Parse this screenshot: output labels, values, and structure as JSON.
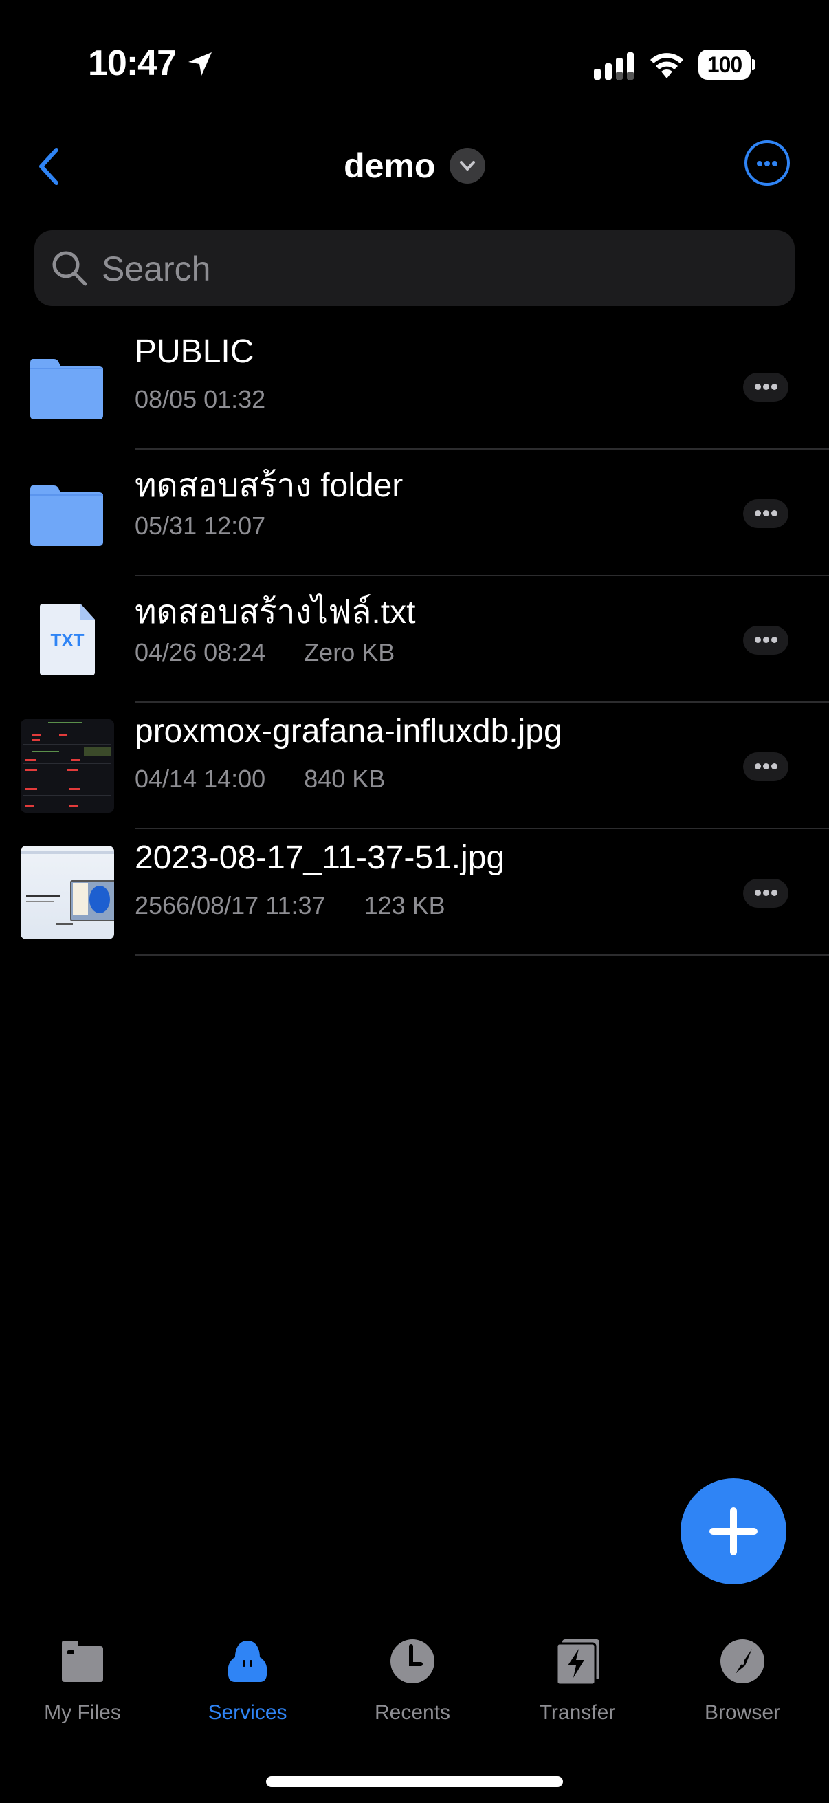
{
  "status_bar": {
    "time": "10:47",
    "battery": "100"
  },
  "nav": {
    "title": "demo",
    "back_icon": "chevron-left-icon",
    "more_icon": "ellipsis-circle-icon",
    "dropdown_icon": "chevron-down-icon"
  },
  "search": {
    "placeholder": "Search",
    "value": ""
  },
  "files": [
    {
      "name": "PUBLIC",
      "date": "08/05 01:32",
      "size": "",
      "type": "folder"
    },
    {
      "name": "ทดสอบสร้าง folder",
      "date": "05/31 12:07",
      "size": "",
      "type": "folder"
    },
    {
      "name": "ทดสอบสร้างไฟล์.txt",
      "date": "04/26 08:24",
      "size": "Zero KB",
      "type": "txt",
      "badge": "TXT"
    },
    {
      "name": "proxmox-grafana-influxdb.jpg",
      "date": "04/14 14:00",
      "size": "840 KB",
      "type": "image"
    },
    {
      "name": "2023-08-17_11-37-51.jpg",
      "date": "2566/08/17 11:37",
      "size": "123 KB",
      "type": "image"
    }
  ],
  "fab": {
    "icon": "plus-icon"
  },
  "tabbar": {
    "active": "Services",
    "tabs": [
      {
        "label": "My Files",
        "icon": "folder-icon"
      },
      {
        "label": "Services",
        "icon": "cloud-icon"
      },
      {
        "label": "Recents",
        "icon": "clock-icon"
      },
      {
        "label": "Transfer",
        "icon": "transfer-icon"
      },
      {
        "label": "Browser",
        "icon": "compass-icon"
      }
    ]
  },
  "colors": {
    "accent": "#2f84f5",
    "folder": "#6fa7f8",
    "secondary_text": "#8e8e93",
    "background": "#000000"
  }
}
